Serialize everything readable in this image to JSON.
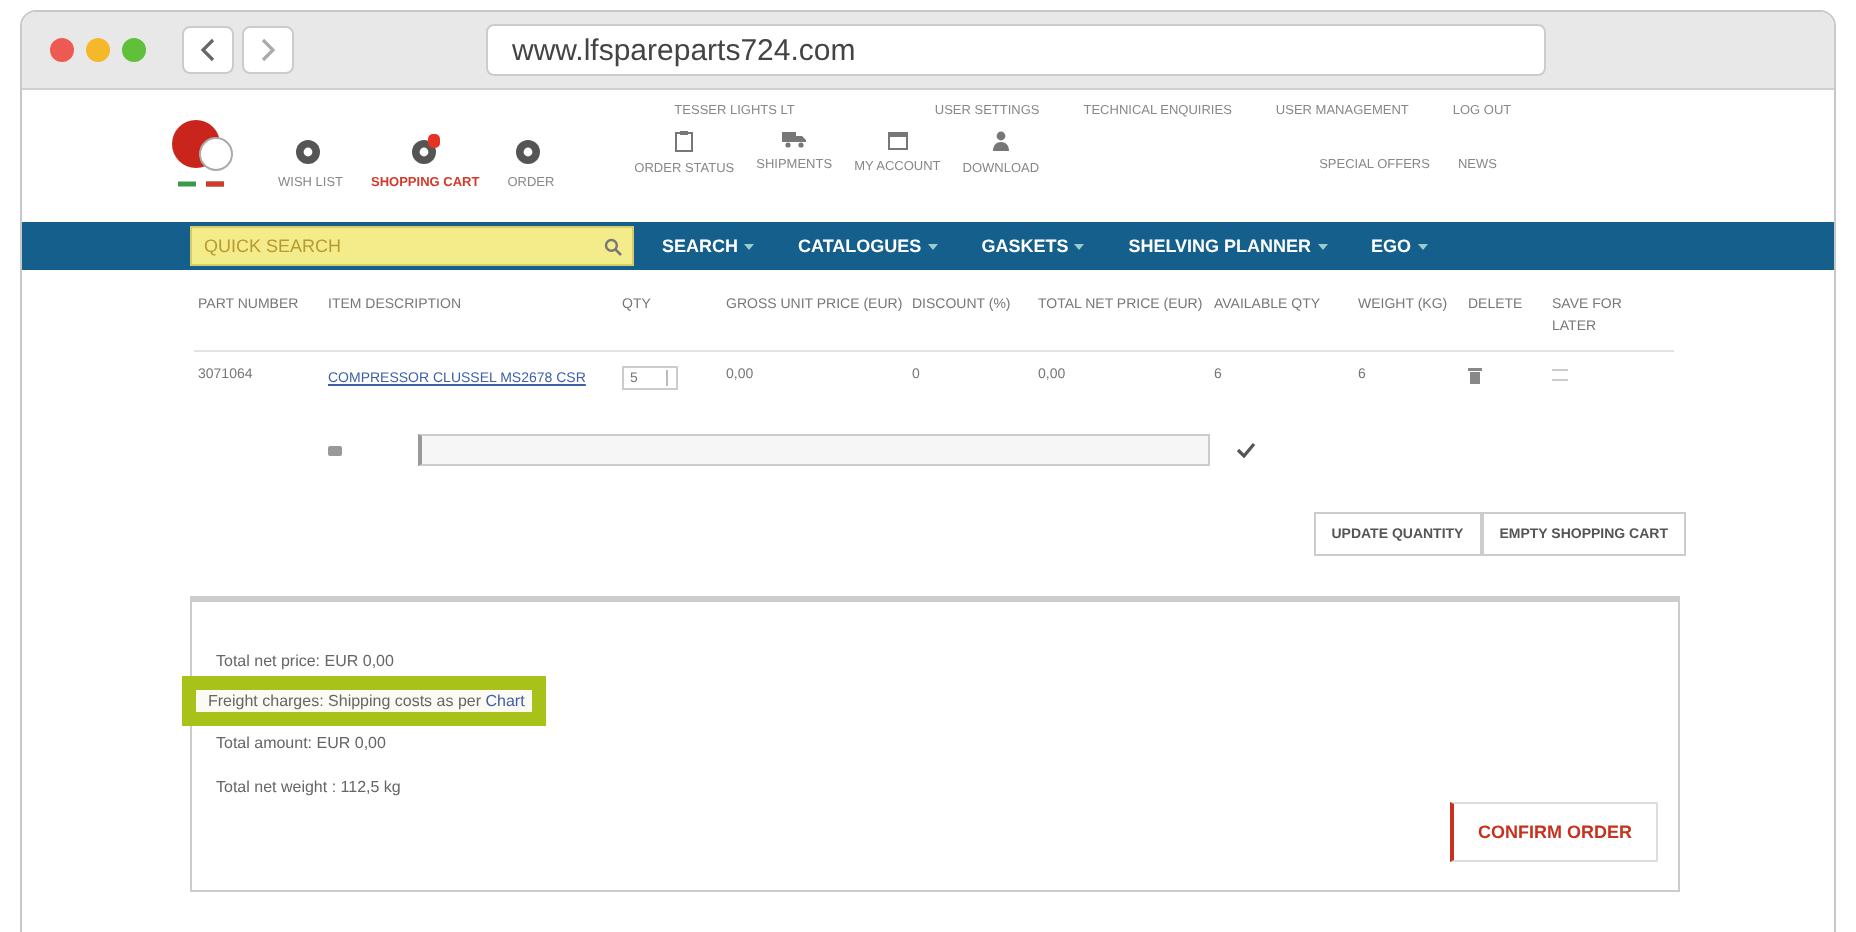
{
  "browser": {
    "url": "www.lfspareparts724.com"
  },
  "header": {
    "user": "TESSER LIGHTS LT",
    "top_links": [
      "USER SETTINGS",
      "TECHNICAL ENQUIRIES",
      "USER MANAGEMENT",
      "LOG OUT"
    ],
    "icon_links": [
      {
        "label": "WISH LIST",
        "selected": false
      },
      {
        "label": "SHOPPING CART",
        "selected": true
      },
      {
        "label": "ORDER",
        "selected": false
      }
    ],
    "account_links": [
      {
        "label": "ORDER STATUS",
        "kind": "clipboard"
      },
      {
        "label": "SHIPMENTS",
        "kind": "truck"
      },
      {
        "label": "MY ACCOUNT",
        "kind": "calendar"
      },
      {
        "label": "DOWNLOAD",
        "kind": "download"
      }
    ],
    "extra_links": [
      "SPECIAL OFFERS",
      "NEWS"
    ]
  },
  "nav": {
    "search": {
      "placeholder": "QUICK SEARCH"
    },
    "menus": [
      "SEARCH",
      "CATALOGUES",
      "GASKETS",
      "SHELVING PLANNER",
      "EGO"
    ]
  },
  "table": {
    "columns": [
      "PART NUMBER",
      "ITEM DESCRIPTION",
      "QTY",
      "GROSS UNIT PRICE (EUR)",
      "DISCOUNT (%)",
      "TOTAL NET PRICE (EUR)",
      "AVAILABLE QTY",
      "WEIGHT (KG)",
      "DELETE",
      "SAVE FOR LATER"
    ],
    "rows": [
      {
        "part": "3071064",
        "description": "COMPRESSOR CLUSSEL MS2678 CSR",
        "qty": "5",
        "gross": "0,00",
        "discount": "0",
        "total": "0,00",
        "available": "6",
        "weight": "6"
      }
    ]
  },
  "buttons": [
    "UPDATE QUANTITY",
    "EMPTY SHOPPING CART"
  ],
  "summary": {
    "lines": [
      {
        "text": "Total net price: EUR 0,00",
        "highlighted": false
      },
      {
        "text": "Freight charges: Shipping costs as per",
        "link": "Chart",
        "highlighted": true
      },
      {
        "text": "Total amount: EUR 0,00",
        "highlighted": false
      },
      {
        "text": "Total net weight : 112,5 kg",
        "highlighted": false
      }
    ],
    "confirm": "CONFIRM ORDER"
  }
}
